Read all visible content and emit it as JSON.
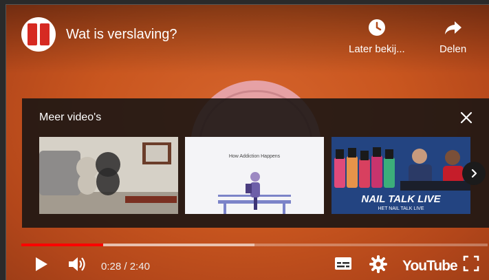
{
  "video": {
    "title": "Wat is verslaving?"
  },
  "top_actions": {
    "watch_later_label": "Later bekij...",
    "share_label": "Delen"
  },
  "more_videos": {
    "title": "Meer video's",
    "thumb2_text": "How Addiction Happens",
    "thumb3_text": "NAIL TALK LIVE",
    "thumb3_subtext": "HET NAIL TALK LIVE"
  },
  "player": {
    "current_time": "0:28",
    "separator": "/",
    "duration": "2:40",
    "progress": 0.176,
    "buffered": 0.5,
    "logo_text": "YouTube"
  },
  "icons": {
    "watch_later": "clock-icon",
    "share": "share-arrow-icon",
    "close": "close-icon",
    "next": "chevron-right-icon",
    "play": "play-icon",
    "volume": "volume-icon",
    "subtitles": "subtitles-icon",
    "settings": "gear-icon",
    "fullscreen": "fullscreen-icon"
  },
  "colors": {
    "progress": "#ff0000",
    "background": "#c9561f",
    "channel_logo": "#d62a22"
  }
}
